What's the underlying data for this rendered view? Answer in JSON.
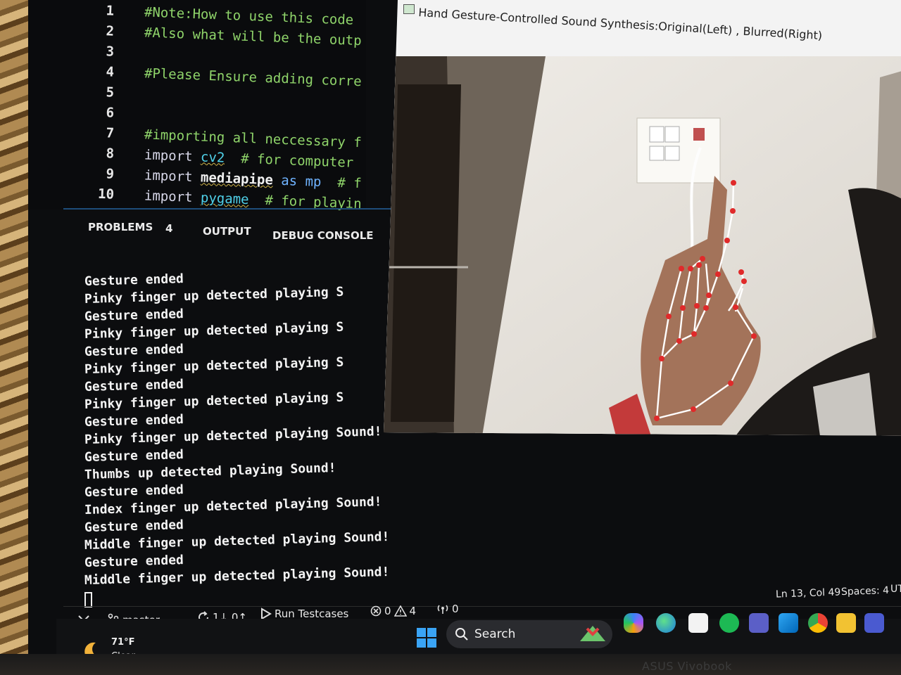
{
  "editor": {
    "lines": [
      {
        "num": "1",
        "segments": [
          {
            "cls": "cm",
            "text": "#Note:How to use this code"
          }
        ]
      },
      {
        "num": "2",
        "segments": [
          {
            "cls": "cm",
            "text": "#Also what will be the outp"
          }
        ]
      },
      {
        "num": "3",
        "segments": []
      },
      {
        "num": "4",
        "segments": [
          {
            "cls": "cm",
            "text": "#Please Ensure adding corre"
          }
        ]
      },
      {
        "num": "5",
        "segments": []
      },
      {
        "num": "6",
        "segments": []
      },
      {
        "num": "7",
        "segments": [
          {
            "cls": "cm",
            "text": "#importing all neccessary f"
          }
        ]
      },
      {
        "num": "8",
        "segments": [
          {
            "cls": "kw",
            "text": "import "
          },
          {
            "cls": "mod",
            "text": "cv2"
          },
          {
            "cls": "cm",
            "text": "  # for computer"
          }
        ]
      },
      {
        "num": "9",
        "segments": [
          {
            "cls": "kw",
            "text": "import "
          },
          {
            "cls": "mod bold",
            "text": "mediapipe"
          },
          {
            "cls": "as",
            "text": " as mp"
          },
          {
            "cls": "cm",
            "text": "  # f"
          }
        ]
      },
      {
        "num": "10",
        "segments": [
          {
            "cls": "kw",
            "text": "import "
          },
          {
            "cls": "mod",
            "text": "pygame"
          },
          {
            "cls": "cm",
            "text": "  # for playin"
          }
        ]
      }
    ]
  },
  "panel": {
    "tabs": {
      "problems": "PROBLEMS",
      "problems_count": "4",
      "output": "OUTPUT",
      "debug": "DEBUG CONSOLE"
    }
  },
  "terminal": {
    "lines": [
      "Gesture ended",
      "Pinky finger up detected playing S",
      "Gesture ended",
      "Pinky finger up detected playing S",
      "Gesture ended",
      "Pinky finger up detected playing S",
      "Gesture ended",
      "Pinky finger up detected playing S",
      "Gesture ended",
      "Pinky finger up detected playing Sound!",
      "Gesture ended",
      "Thumbs up detected playing Sound!",
      "Gesture ended",
      "Index finger up detected playing Sound!",
      "Gesture ended",
      "Middle finger up detected playing Sound!",
      "Gesture ended",
      "Middle finger up detected playing Sound!"
    ]
  },
  "statusbar": {
    "branch": "master",
    "sync": "1↓ 0↑",
    "run": "Run Testcases",
    "errors": "0",
    "warnings": "4",
    "ports": "0",
    "position": "Ln 13, Col 49",
    "spaces": "Spaces: 4",
    "encoding": "UTF"
  },
  "camera_window": {
    "title": "Hand Gesture-Controlled Sound Synthesis:Original(Left) , Blurred(Right)"
  },
  "taskbar": {
    "weather_temp": "71°F",
    "weather_desc": "Clear",
    "search_label": "Search"
  },
  "device": {
    "brand": "ASUS Vivobook"
  },
  "colors": {
    "accent_blue": "#3aa4f5",
    "comment_green": "#8fd46a",
    "module_cyan": "#4fd0e8",
    "landmark_red": "#e02a2a"
  }
}
